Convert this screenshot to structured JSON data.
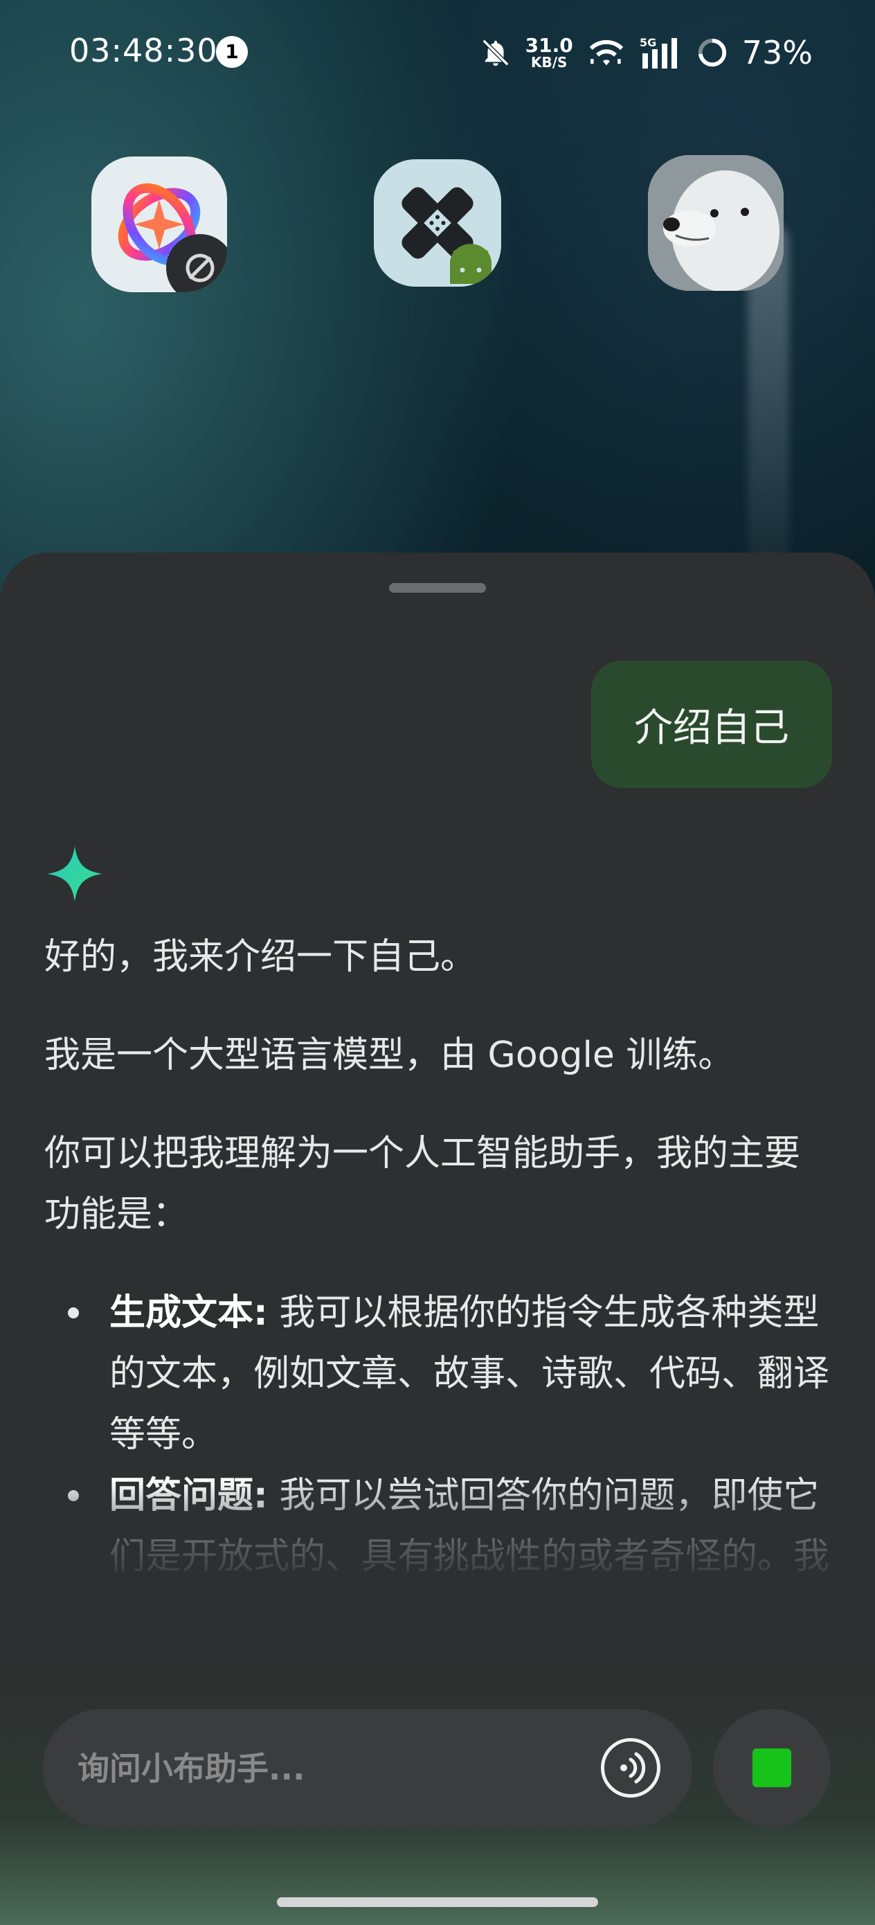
{
  "status_bar": {
    "time": "03:48:30",
    "notification_count": "1",
    "net_speed_value": "31.0",
    "net_speed_unit": "KB/S",
    "signal_label": "5G",
    "battery": "73%",
    "icons": [
      "bell-off-icon",
      "wifi-icon",
      "signal-icon",
      "battery-ring-icon"
    ]
  },
  "home_apps": [
    {
      "name": "app-colorful-loop",
      "icon": "app-icon"
    },
    {
      "name": "app-bandage-android",
      "icon": "app-icon"
    },
    {
      "name": "app-polar-bear",
      "icon": "app-icon"
    }
  ],
  "chat": {
    "user_message": "介绍自己",
    "response": {
      "intro": "好的，我来介绍一下自己。",
      "identity": "我是一个大型语言模型，由 Google 训练。",
      "functions_intro": "你可以把我理解为一个人工智能助手，我的主要功能是：",
      "bullets": [
        {
          "title": "生成文本:",
          "text": " 我可以根据你的指令生成各种类型的文本，例如文章、故事、诗歌、代码、翻译等等。"
        },
        {
          "title": "回答问题:",
          "text": " 我可以尝试回答你的问题，即使它们是开放式的、具有挑战性的或者奇怪的。我会尽力"
        }
      ]
    }
  },
  "input": {
    "placeholder": "询问小布助手..."
  },
  "colors": {
    "sheet_bg": "#2e2f30",
    "user_bubble": "#2a4a2e",
    "stop_accent": "#17c21a",
    "spark_from": "#24c7c0",
    "spark_to": "#3ee08a"
  }
}
